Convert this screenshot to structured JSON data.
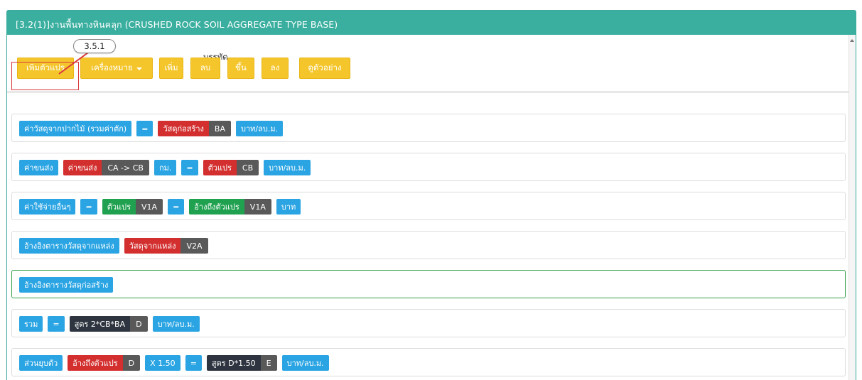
{
  "panel": {
    "title": "[3.2(1)]งานพื้นทางหินคลุก (CRUSHED ROCK SOIL AGGREGATE TYPE BASE)"
  },
  "toolbar": {
    "add_variable": "เพิ่มตัวแปร",
    "symbols": "เครื่องหมาย",
    "line_group_label": "บรรทัด",
    "line_add": "เพิ่ม",
    "line_delete": "ลบ",
    "line_up": "ขึ้น",
    "line_down": "ลง",
    "preview": "ดูตัวอย่าง"
  },
  "callout": {
    "label": "3.5.1"
  },
  "rows": {
    "r1": {
      "a": "ค่าวัสดุจากปากไม้ (รวมค่าตัก)",
      "eq": "=",
      "c_label": "วัสดุก่อสร้าง",
      "c_code": "BA",
      "unit": "บาท/ลบ.ม."
    },
    "r2": {
      "a": "ค่าขนส่ง",
      "b_label": "ค่าขนส่ง",
      "b_code": "CA -> CB",
      "km": "กม.",
      "eq": "=",
      "c_label": "ตัวแปร",
      "c_code": "CB",
      "unit": "บาท/ลบ.ม."
    },
    "r3": {
      "a": "ค่าใช้จ่ายอื่นๆ",
      "eq1": "=",
      "b_label": "ตัวแปร",
      "b_code": "V1A",
      "eq2": "=",
      "c_label": "อ้างถึงตัวแปร",
      "c_code": "V1A",
      "unit": "บาท"
    },
    "r4": {
      "a": "อ้างอิงตารางวัสดุจากแหล่ง",
      "b_label": "วัสดุจากแหล่ง",
      "b_code": "V2A"
    },
    "r5": {
      "a": "อ้างอิงตารางวัสดุก่อสร้าง"
    },
    "r6": {
      "a": "รวม",
      "eq": "=",
      "b_label": "สูตร 2*CB*BA",
      "b_code": "D",
      "unit": "บาท/ลบ.ม."
    },
    "r7": {
      "a": "ส่วนยุบตัว",
      "b_label": "อ้างถึงตัวแปร",
      "b_code": "D",
      "mult": "X 1.50",
      "eq": "=",
      "c_label": "สูตร D*1.50",
      "c_code": "E",
      "unit": "บาท/ลบ.ม."
    }
  },
  "colors": {
    "header": "#3aaf9f",
    "yellow": "#f4c62c",
    "blue": "#2aa4e3",
    "red": "#d32f2f",
    "green": "#20a150",
    "dark": "#2e3540",
    "code_bg": "#595959",
    "callout_red": "#d9383a"
  }
}
